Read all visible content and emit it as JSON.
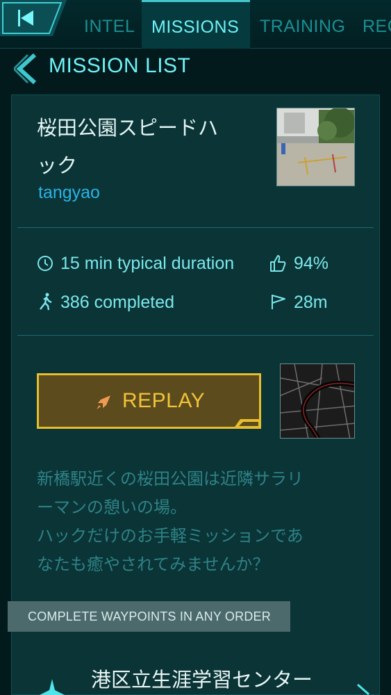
{
  "topbar": {
    "back_icon": "back-arrow-icon",
    "tabs": [
      {
        "label": "INTEL",
        "active": false
      },
      {
        "label": "MISSIONS",
        "active": true
      },
      {
        "label": "TRAINING",
        "active": false
      },
      {
        "label": "REC",
        "active": false
      }
    ]
  },
  "list_header": {
    "back_icon": "chevron-left-icon",
    "title": "MISSION LIST"
  },
  "mission": {
    "title_line1": "桜田公園スピードハ",
    "title_line2": "ック",
    "author": "tangyao",
    "stats": {
      "duration": "15 min typical duration",
      "rating": "94%",
      "completed": "386 completed",
      "distance": "28m"
    },
    "replay_label": "REPLAY",
    "description_lines": [
      "新橋駅近くの桜田公園は近隣サラリ",
      "ーマンの憩いの場。",
      "ハックだけのお手軽ミッションであ",
      "なたも癒やされてみませんか？"
    ],
    "order_banner": "COMPLETE WAYPOINTS IN ANY ORDER",
    "first_waypoint": "港区立生涯学習センター"
  },
  "colors": {
    "background": "#021a1c",
    "card": "#0a3436",
    "accent_cyan": "#6ff2f7",
    "author_blue": "#2ab4e6",
    "replay_gold": "#e7be30"
  }
}
